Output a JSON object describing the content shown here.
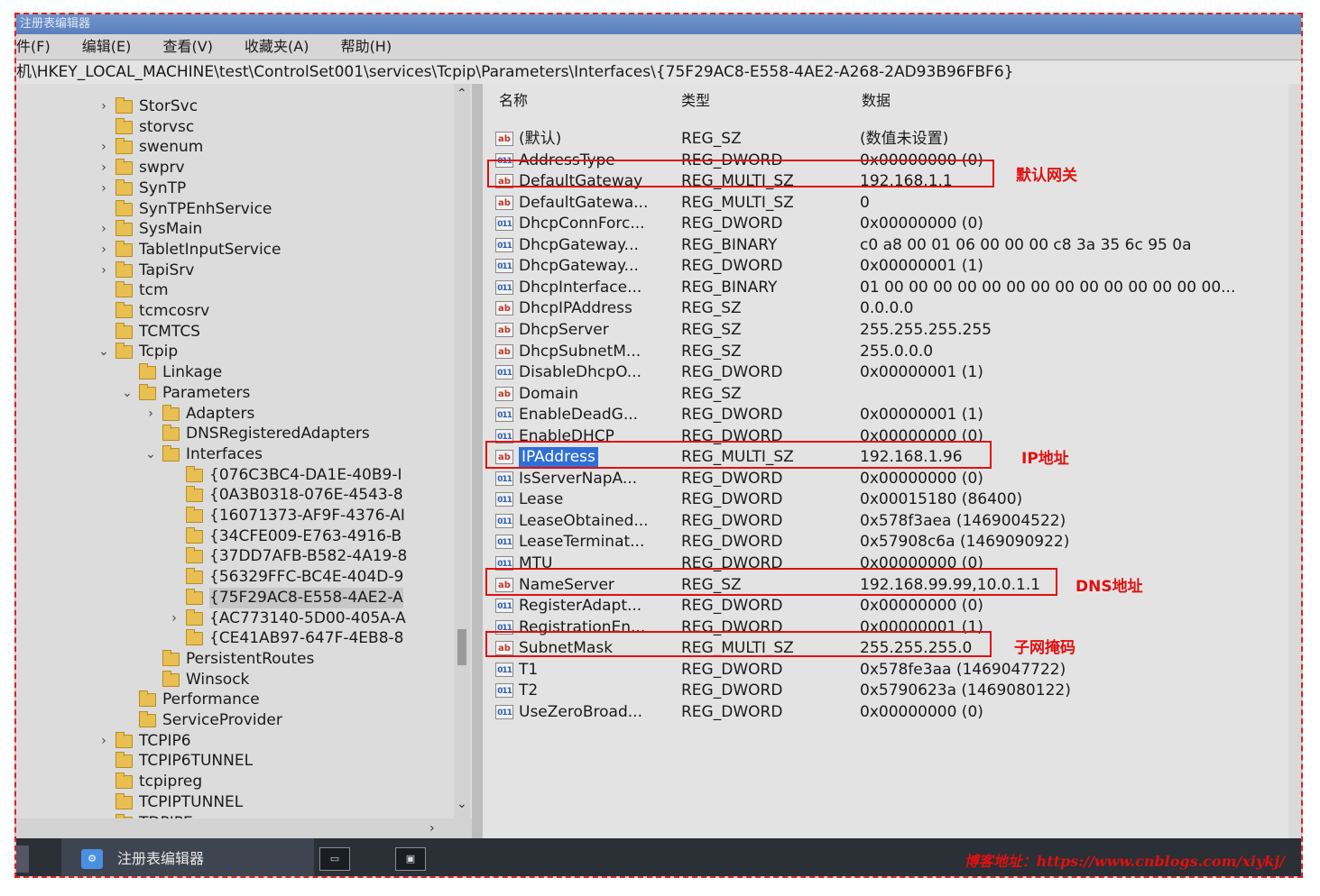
{
  "window": {
    "title": "注册表编辑器"
  },
  "menu": [
    "件(F)",
    "编辑(E)",
    "查看(V)",
    "收藏夹(A)",
    "帮助(H)"
  ],
  "address": "机\\HKEY_LOCAL_MACHINE\\test\\ControlSet001\\services\\Tcpip\\Parameters\\Interfaces\\{75F29AC8-E558-4AE2-A268-2AD93B96FBF6}",
  "tree": [
    {
      "label": "StorSvc",
      "level": 0,
      "chev": "›"
    },
    {
      "label": "storvsc",
      "level": 0,
      "chev": ""
    },
    {
      "label": "swenum",
      "level": 0,
      "chev": "›"
    },
    {
      "label": "swprv",
      "level": 0,
      "chev": "›"
    },
    {
      "label": "SynTP",
      "level": 0,
      "chev": "›"
    },
    {
      "label": "SynTPEnhService",
      "level": 0,
      "chev": ""
    },
    {
      "label": "SysMain",
      "level": 0,
      "chev": "›"
    },
    {
      "label": "TabletInputService",
      "level": 0,
      "chev": "›"
    },
    {
      "label": "TapiSrv",
      "level": 0,
      "chev": "›"
    },
    {
      "label": "tcm",
      "level": 0,
      "chev": ""
    },
    {
      "label": "tcmcosrv",
      "level": 0,
      "chev": ""
    },
    {
      "label": "TCMTCS",
      "level": 0,
      "chev": ""
    },
    {
      "label": "Tcpip",
      "level": 0,
      "chev": "⌄"
    },
    {
      "label": "Linkage",
      "level": 1,
      "chev": ""
    },
    {
      "label": "Parameters",
      "level": 1,
      "chev": "⌄"
    },
    {
      "label": "Adapters",
      "level": 2,
      "chev": "›"
    },
    {
      "label": "DNSRegisteredAdapters",
      "level": 2,
      "chev": ""
    },
    {
      "label": "Interfaces",
      "level": 2,
      "chev": "⌄"
    },
    {
      "label": "{076C3BC4-DA1E-40B9-I",
      "level": 3,
      "chev": ""
    },
    {
      "label": "{0A3B0318-076E-4543-8",
      "level": 3,
      "chev": ""
    },
    {
      "label": "{16071373-AF9F-4376-AI",
      "level": 3,
      "chev": ""
    },
    {
      "label": "{34CFE009-E763-4916-B",
      "level": 3,
      "chev": ""
    },
    {
      "label": "{37DD7AFB-B582-4A19-8",
      "level": 3,
      "chev": ""
    },
    {
      "label": "{56329FFC-BC4E-404D-9",
      "level": 3,
      "chev": ""
    },
    {
      "label": "{75F29AC8-E558-4AE2-A",
      "level": 3,
      "chev": "",
      "selected": true
    },
    {
      "label": "{AC773140-5D00-405A-A",
      "level": 3,
      "chev": "›"
    },
    {
      "label": "{CE41AB97-647F-4EB8-8",
      "level": 3,
      "chev": ""
    },
    {
      "label": "PersistentRoutes",
      "level": 2,
      "chev": ""
    },
    {
      "label": "Winsock",
      "level": 2,
      "chev": ""
    },
    {
      "label": "Performance",
      "level": 1,
      "chev": ""
    },
    {
      "label": "ServiceProvider",
      "level": 1,
      "chev": ""
    },
    {
      "label": "TCPIP6",
      "level": 0,
      "chev": "›"
    },
    {
      "label": "TCPIP6TUNNEL",
      "level": 0,
      "chev": ""
    },
    {
      "label": "tcpipreg",
      "level": 0,
      "chev": ""
    },
    {
      "label": "TCPIPTUNNEL",
      "level": 0,
      "chev": ""
    },
    {
      "label": "TDPIPE",
      "level": 0,
      "chev": ""
    }
  ],
  "columns": {
    "name": "名称",
    "type": "类型",
    "data": "数据"
  },
  "values": [
    {
      "icon": "ab",
      "name": "(默认)",
      "type": "REG_SZ",
      "data": "(数值未设置)"
    },
    {
      "icon": "bin",
      "name": "AddressType",
      "type": "REG_DWORD",
      "data": "0x00000000 (0)"
    },
    {
      "icon": "ab",
      "name": "DefaultGateway",
      "type": "REG_MULTI_SZ",
      "data": "192.168.1.1"
    },
    {
      "icon": "ab",
      "name": "DefaultGatewa...",
      "type": "REG_MULTI_SZ",
      "data": "0"
    },
    {
      "icon": "bin",
      "name": "DhcpConnForc...",
      "type": "REG_DWORD",
      "data": "0x00000000 (0)"
    },
    {
      "icon": "bin",
      "name": "DhcpGateway...",
      "type": "REG_BINARY",
      "data": "c0 a8 00 01 06 00 00 00 c8 3a 35 6c 95 0a"
    },
    {
      "icon": "bin",
      "name": "DhcpGateway...",
      "type": "REG_DWORD",
      "data": "0x00000001 (1)"
    },
    {
      "icon": "bin",
      "name": "DhcpInterface...",
      "type": "REG_BINARY",
      "data": "01 00 00 00 00 00 00 00 00 00 00 00 00 00 00..."
    },
    {
      "icon": "ab",
      "name": "DhcpIPAddress",
      "type": "REG_SZ",
      "data": "0.0.0.0"
    },
    {
      "icon": "ab",
      "name": "DhcpServer",
      "type": "REG_SZ",
      "data": "255.255.255.255"
    },
    {
      "icon": "ab",
      "name": "DhcpSubnetM...",
      "type": "REG_SZ",
      "data": "255.0.0.0"
    },
    {
      "icon": "bin",
      "name": "DisableDhcpO...",
      "type": "REG_DWORD",
      "data": "0x00000001 (1)"
    },
    {
      "icon": "ab",
      "name": "Domain",
      "type": "REG_SZ",
      "data": ""
    },
    {
      "icon": "bin",
      "name": "EnableDeadG...",
      "type": "REG_DWORD",
      "data": "0x00000001 (1)"
    },
    {
      "icon": "bin",
      "name": "EnableDHCP",
      "type": "REG_DWORD",
      "data": "0x00000000 (0)"
    },
    {
      "icon": "ab",
      "name": "IPAddress",
      "type": "REG_MULTI_SZ",
      "data": "192.168.1.96",
      "selected": true
    },
    {
      "icon": "bin",
      "name": "IsServerNapA...",
      "type": "REG_DWORD",
      "data": "0x00000000 (0)"
    },
    {
      "icon": "bin",
      "name": "Lease",
      "type": "REG_DWORD",
      "data": "0x00015180 (86400)"
    },
    {
      "icon": "bin",
      "name": "LeaseObtained...",
      "type": "REG_DWORD",
      "data": "0x578f3aea (1469004522)"
    },
    {
      "icon": "bin",
      "name": "LeaseTerminat...",
      "type": "REG_DWORD",
      "data": "0x57908c6a (1469090922)"
    },
    {
      "icon": "bin",
      "name": "MTU",
      "type": "REG_DWORD",
      "data": "0x00000000 (0)"
    },
    {
      "icon": "ab",
      "name": "NameServer",
      "type": "REG_SZ",
      "data": "192.168.99.99,10.0.1.1"
    },
    {
      "icon": "bin",
      "name": "RegisterAdapt...",
      "type": "REG_DWORD",
      "data": "0x00000000 (0)"
    },
    {
      "icon": "bin",
      "name": "RegistrationEn...",
      "type": "REG_DWORD",
      "data": "0x00000001 (1)"
    },
    {
      "icon": "ab",
      "name": "SubnetMask",
      "type": "REG_MULTI_SZ",
      "data": "255.255.255.0"
    },
    {
      "icon": "bin",
      "name": "T1",
      "type": "REG_DWORD",
      "data": "0x578fe3aa (1469047722)"
    },
    {
      "icon": "bin",
      "name": "T2",
      "type": "REG_DWORD",
      "data": "0x5790623a (1469080122)"
    },
    {
      "icon": "bin",
      "name": "UseZeroBroad...",
      "type": "REG_DWORD",
      "data": "0x00000000 (0)"
    }
  ],
  "annotations": {
    "gateway": "默认网关",
    "ip": "IP地址",
    "dns": "DNS地址",
    "mask": "子网掩码"
  },
  "icons": {
    "string": "ab",
    "binary": "011"
  },
  "taskbar": {
    "active_app": "注册表编辑器",
    "watermark": "博客地址：https://www.cnblogs.com/xiykj/"
  },
  "colors": {
    "highlight": "#e01010",
    "selection": "#2f6fd6"
  }
}
